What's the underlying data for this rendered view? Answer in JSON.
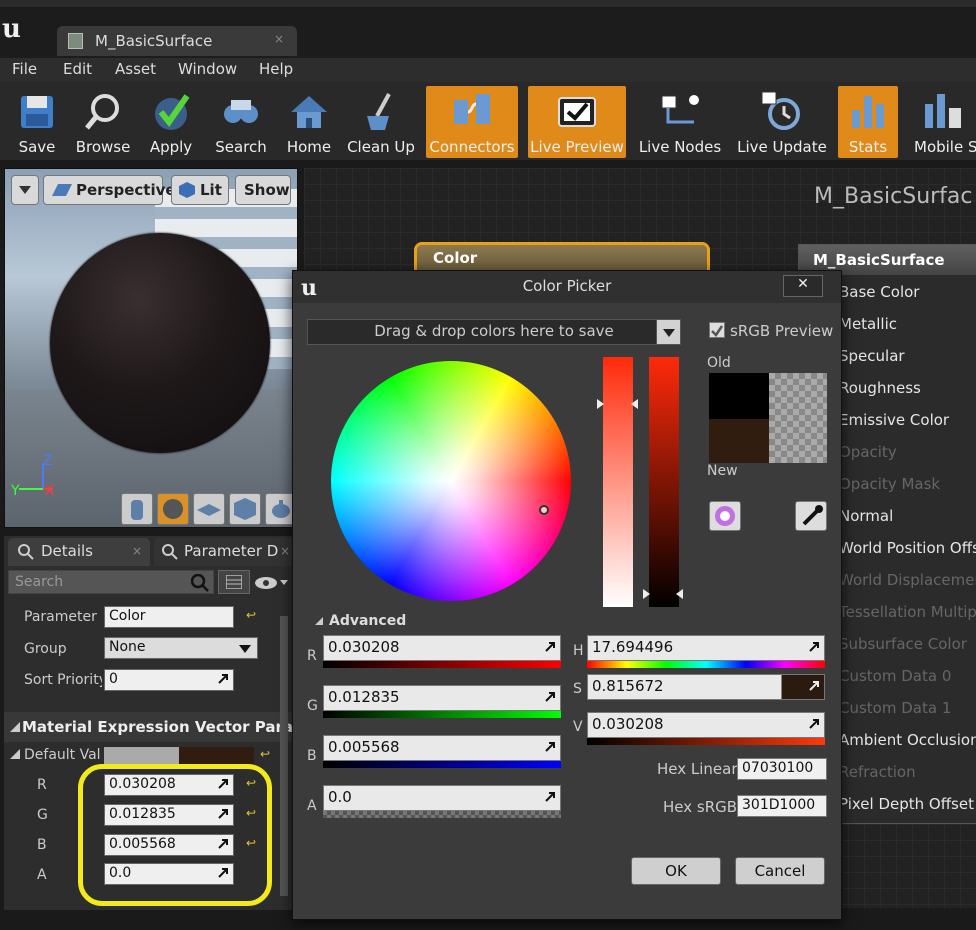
{
  "window": {
    "tab_title": "M_BasicSurface",
    "tab_close": "×"
  },
  "menu": [
    "File",
    "Edit",
    "Asset",
    "Window",
    "Help"
  ],
  "toolbar": {
    "items": [
      {
        "label": "Save",
        "icon": "save-icon",
        "active": false
      },
      {
        "label": "Browse",
        "icon": "browse-icon",
        "active": false
      },
      {
        "label": "Apply",
        "icon": "apply-icon",
        "active": false
      },
      {
        "label": "Search",
        "icon": "search-icon",
        "active": false
      },
      {
        "label": "Home",
        "icon": "home-icon",
        "active": false
      },
      {
        "label": "Clean Up",
        "icon": "cleanup-icon",
        "active": false
      },
      {
        "label": "Connectors",
        "icon": "connectors-icon",
        "active": true
      },
      {
        "label": "Live Preview",
        "icon": "live-preview-icon",
        "active": true
      },
      {
        "label": "Live Nodes",
        "icon": "live-nodes-icon",
        "active": false
      },
      {
        "label": "Live Update",
        "icon": "live-update-icon",
        "active": false
      },
      {
        "label": "Stats",
        "icon": "stats-icon",
        "active": true
      },
      {
        "label": "Mobile St",
        "icon": "mobile-stats-icon",
        "active": false
      }
    ]
  },
  "viewport": {
    "perspective": "Perspective",
    "lit": "Lit",
    "show": "Show",
    "axis_z": "Z",
    "axis_x": "X",
    "axis_y": "Y"
  },
  "details": {
    "tab_details": "Details",
    "tab_params": "Parameter D",
    "tab_close": "×",
    "search_placeholder": "Search",
    "parameter_label": "Parameter N",
    "parameter_value": "Color",
    "group_label": "Group",
    "group_value": "None",
    "sort_label": "Sort Priority",
    "sort_value": "0",
    "section_title": "Material Expression Vector Paramete",
    "default_label": "Default Val",
    "r_label": "R",
    "r_value": "0.030208",
    "g_label": "G",
    "g_value": "0.012835",
    "b_label": "B",
    "b_value": "0.005568",
    "a_label": "A",
    "a_value": "0.0"
  },
  "graph": {
    "title": "M_BasicSurfac",
    "color_node": "Color",
    "material_node": "M_BasicSurface",
    "pins": [
      {
        "label": "Base Color",
        "enabled": true
      },
      {
        "label": "Metallic",
        "enabled": true
      },
      {
        "label": "Specular",
        "enabled": true
      },
      {
        "label": "Roughness",
        "enabled": true
      },
      {
        "label": "Emissive Color",
        "enabled": true
      },
      {
        "label": "Opacity",
        "enabled": false
      },
      {
        "label": "Opacity Mask",
        "enabled": false
      },
      {
        "label": "Normal",
        "enabled": true
      },
      {
        "label": "World Position Offse",
        "enabled": true
      },
      {
        "label": "World Displacement",
        "enabled": false
      },
      {
        "label": "Tessellation Multipli",
        "enabled": false
      },
      {
        "label": "Subsurface Color",
        "enabled": false
      },
      {
        "label": "Custom Data 0",
        "enabled": false
      },
      {
        "label": "Custom Data 1",
        "enabled": false
      },
      {
        "label": "Ambient Occlusion",
        "enabled": true
      },
      {
        "label": "Refraction",
        "enabled": false
      },
      {
        "label": "Pixel Depth Offset",
        "enabled": true
      }
    ]
  },
  "color_picker": {
    "title": "Color Picker",
    "close": "✕",
    "drop_hint": "Drag & drop colors here to save",
    "srgb_preview": "sRGB Preview",
    "srgb_checked": true,
    "old_label": "Old",
    "new_label": "New",
    "old_color": "#000000",
    "new_color": "#301D10",
    "advanced": "Advanced",
    "r_label": "R",
    "r_value": "0.030208",
    "g_label": "G",
    "g_value": "0.012835",
    "b_label": "B",
    "b_value": "0.005568",
    "a_label": "A",
    "a_value": "0.0",
    "h_label": "H",
    "h_value": "17.694496",
    "s_label": "S",
    "s_value": "0.815672",
    "v_label": "V",
    "v_value": "0.030208",
    "hex_linear_label": "Hex Linear",
    "hex_linear_value": "07030100",
    "hex_srgb_label": "Hex sRGB",
    "hex_srgb_value": "301D1000",
    "ok": "OK",
    "cancel": "Cancel"
  },
  "colors": {
    "accent": "#E08A1A",
    "highlight": "#F2EA1A"
  }
}
